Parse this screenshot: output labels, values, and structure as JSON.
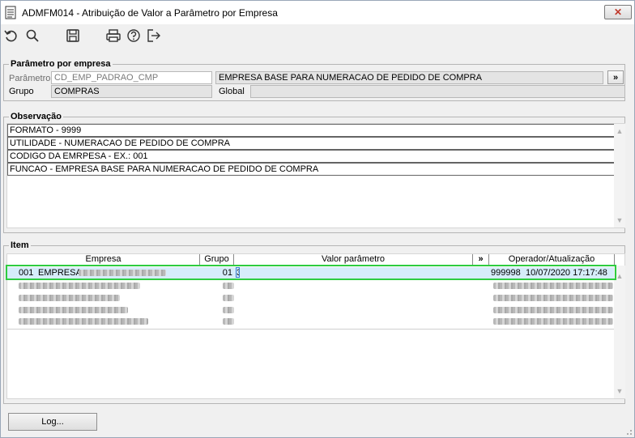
{
  "window": {
    "title": "ADMFM014 - Atribuição de Valor a Parâmetro por Empresa",
    "close_label": "✕"
  },
  "toolbar": {
    "icons": [
      "undo-icon",
      "search-icon",
      "save-icon",
      "print-icon",
      "help-icon",
      "exit-icon"
    ]
  },
  "parametro_section": {
    "legend": "Parâmetro por empresa",
    "parametro_label": "Parâmetro",
    "parametro_value": "CD_EMP_PADRAO_CMP",
    "parametro_desc": "EMPRESA BASE PARA NUMERACAO DE PEDIDO DE COMPRA",
    "expand_label": "»",
    "grupo_label": "Grupo",
    "grupo_value": "COMPRAS",
    "global_label": "Global",
    "global_value": ""
  },
  "observacao_section": {
    "legend": "Observação",
    "lines": [
      "FORMATO - 9999",
      "UTILIDADE -  NUMERACAO DE PEDIDO DE COMPRA",
      "CODIGO DA EMRPESA - EX.: 001",
      "FUNCAO - EMPRESA BASE PARA NUMERACAO DE PEDIDO DE COMPRA"
    ]
  },
  "item_section": {
    "legend": "Item",
    "columns": {
      "empresa": "Empresa",
      "grupo": "Grupo",
      "valor": "Valor parâmetro",
      "expand": "»",
      "operador": "Operador/Atualização"
    },
    "rows": [
      {
        "codigo": "001",
        "empresa": "EMPRESA",
        "grupo": "01",
        "valor": "3",
        "operador": "999998",
        "atualizacao": "10/07/2020 17:17:48"
      }
    ]
  },
  "footer": {
    "log_label": "Log..."
  },
  "colors": {
    "highlight": "#2ecc40",
    "selected_row": "#d6ecfa"
  }
}
